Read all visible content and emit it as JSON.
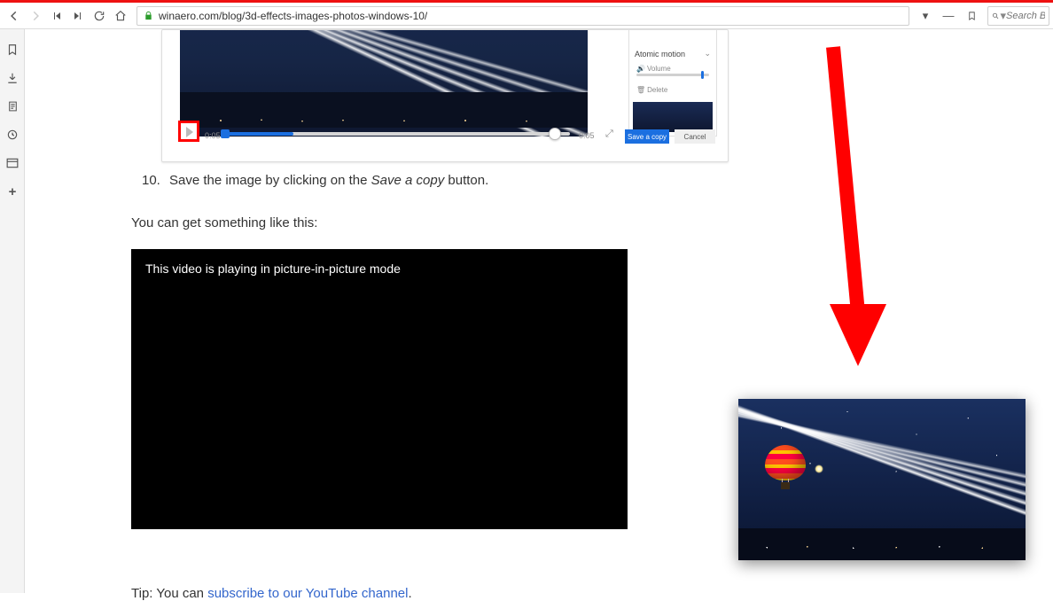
{
  "toolbar": {
    "url": "winaero.com/blog/3d-effects-images-photos-windows-10/",
    "search_placeholder": "Search B"
  },
  "app_shot": {
    "effects_label": "Atomic motion",
    "volume_label": "Volume",
    "delete_label": "Delete",
    "time_start": "0:05",
    "time_end": "0:05",
    "save_button": "Save a copy",
    "cancel_button": "Cancel"
  },
  "step10": {
    "num": "10.",
    "t1": "Save the image by clicking on the ",
    "em": "Save a copy",
    "t2": " button."
  },
  "lead": "You can get something like this:",
  "video_msg": "This video is playing in picture-in-picture mode",
  "tip": {
    "prefix": "Tip: You can ",
    "link": "subscribe to our YouTube channel",
    "suffix": "."
  }
}
